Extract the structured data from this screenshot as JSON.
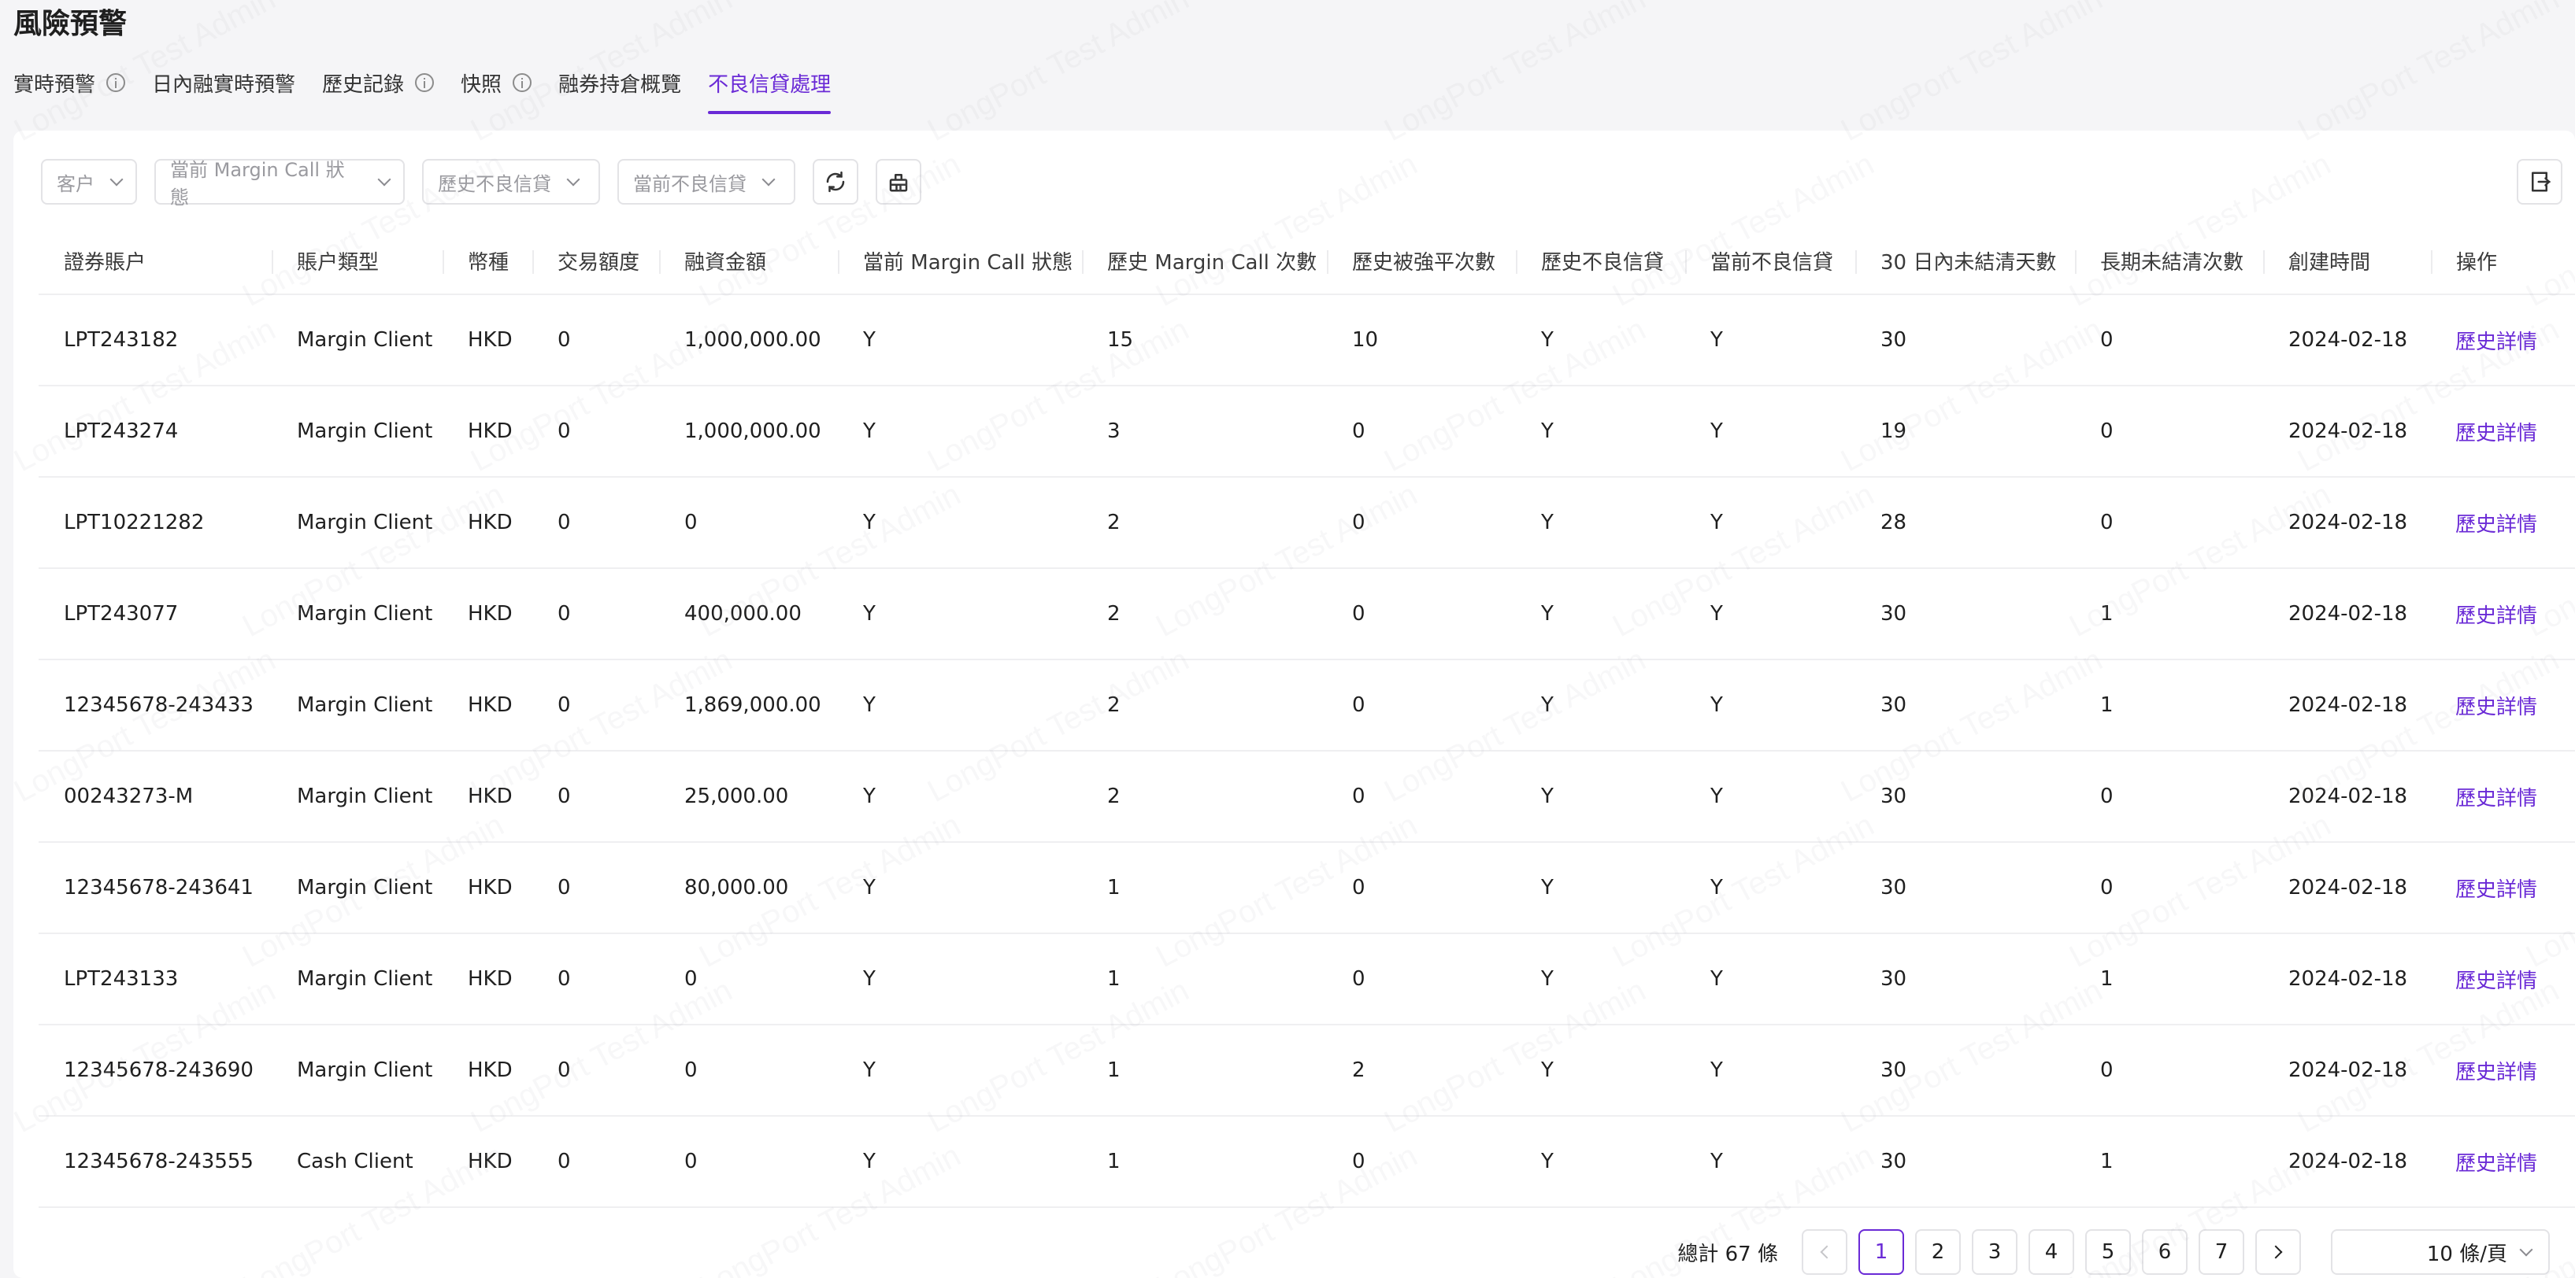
{
  "page": {
    "title": "風險預警",
    "tabs": [
      {
        "label": "實時預警",
        "info": true
      },
      {
        "label": "日內融實時預警",
        "info": false
      },
      {
        "label": "歷史記錄",
        "info": true
      },
      {
        "label": "快照",
        "info": true
      },
      {
        "label": "融券持倉概覽",
        "info": false
      },
      {
        "label": "不良信貸處理",
        "info": false,
        "active": true
      }
    ]
  },
  "filters": {
    "customer": "客户",
    "margin_call_status": "當前 Margin Call 狀態",
    "history_bad_credit": "歷史不良信貸",
    "current_bad_credit": "當前不良信貸"
  },
  "icons": {
    "refresh": "refresh-icon",
    "clear": "clear-icon",
    "export": "export-icon"
  },
  "table": {
    "columns": [
      "證券賬户",
      "賬户類型",
      "幣種",
      "交易額度",
      "融資金額",
      "當前 Margin Call 狀態",
      "歷史 Margin Call 次數",
      "歷史被強平次數",
      "歷史不良信貸",
      "當前不良信貸",
      "30 日內未結清天數",
      "長期未結清次數",
      "創建時間",
      "操作"
    ],
    "rows": [
      [
        "LPT243182",
        "Margin Client",
        "HKD",
        "0",
        "1,000,000.00",
        "Y",
        "15",
        "10",
        "Y",
        "Y",
        "30",
        "0",
        "2024-02-18",
        "歷史詳情"
      ],
      [
        "LPT243274",
        "Margin Client",
        "HKD",
        "0",
        "1,000,000.00",
        "Y",
        "3",
        "0",
        "Y",
        "Y",
        "19",
        "0",
        "2024-02-18",
        "歷史詳情"
      ],
      [
        "LPT10221282",
        "Margin Client",
        "HKD",
        "0",
        "0",
        "Y",
        "2",
        "0",
        "Y",
        "Y",
        "28",
        "0",
        "2024-02-18",
        "歷史詳情"
      ],
      [
        "LPT243077",
        "Margin Client",
        "HKD",
        "0",
        "400,000.00",
        "Y",
        "2",
        "0",
        "Y",
        "Y",
        "30",
        "1",
        "2024-02-18",
        "歷史詳情"
      ],
      [
        "12345678-243433",
        "Margin Client",
        "HKD",
        "0",
        "1,869,000.00",
        "Y",
        "2",
        "0",
        "Y",
        "Y",
        "30",
        "1",
        "2024-02-18",
        "歷史詳情"
      ],
      [
        "00243273-M",
        "Margin Client",
        "HKD",
        "0",
        "25,000.00",
        "Y",
        "2",
        "0",
        "Y",
        "Y",
        "30",
        "0",
        "2024-02-18",
        "歷史詳情"
      ],
      [
        "12345678-243641",
        "Margin Client",
        "HKD",
        "0",
        "80,000.00",
        "Y",
        "1",
        "0",
        "Y",
        "Y",
        "30",
        "0",
        "2024-02-18",
        "歷史詳情"
      ],
      [
        "LPT243133",
        "Margin Client",
        "HKD",
        "0",
        "0",
        "Y",
        "1",
        "0",
        "Y",
        "Y",
        "30",
        "1",
        "2024-02-18",
        "歷史詳情"
      ],
      [
        "12345678-243690",
        "Margin Client",
        "HKD",
        "0",
        "0",
        "Y",
        "1",
        "2",
        "Y",
        "Y",
        "30",
        "0",
        "2024-02-18",
        "歷史詳情"
      ],
      [
        "12345678-243555",
        "Cash Client",
        "HKD",
        "0",
        "0",
        "Y",
        "1",
        "0",
        "Y",
        "Y",
        "30",
        "1",
        "2024-02-18",
        "歷史詳情"
      ]
    ]
  },
  "pagination": {
    "total": "總計 67 條",
    "pages": [
      "1",
      "2",
      "3",
      "4",
      "5",
      "6",
      "7"
    ],
    "current": "1",
    "page_size": "10 條/頁"
  },
  "watermark": "LongPort Test Admin",
  "colors": {
    "accent": "#6a2ad6",
    "border": "#e3e3e6",
    "background": "#f5f5f7"
  }
}
